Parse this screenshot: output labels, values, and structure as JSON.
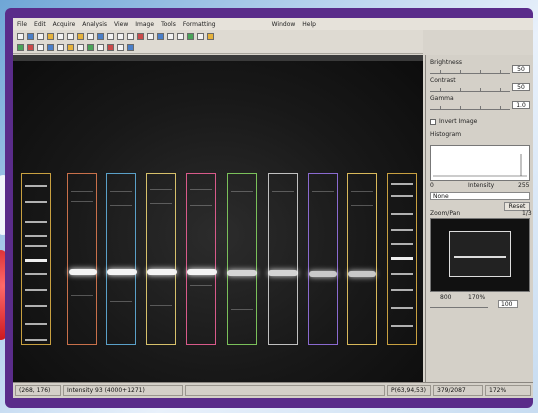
{
  "menu": [
    "File",
    "Edit",
    "Acquire",
    "Analysis",
    "View",
    "Image",
    "Tools",
    "Formatting",
    "Window",
    "Help"
  ],
  "panel": {
    "brightness_label": "Brightness",
    "contrast_label": "Contrast",
    "gamma_label": "Gamma",
    "brightness_value": "50",
    "contrast_value": "50",
    "gamma_value": "1.0",
    "invert_label": "Invert Image",
    "histogram_label": "Histogram",
    "histo_left": "0",
    "histo_mid": "Intensity",
    "histo_right": "255",
    "mode_value": "None",
    "apply_label": "Reset",
    "overview_label": "Zoom/Pan",
    "overview_value": "1/3",
    "zoom_left": "800",
    "zoom_mid": "170%",
    "zoom_field": "100"
  },
  "status": {
    "coords": "(268, 176)",
    "intensity": "Intensity 93 (4000+1271)",
    "pixel": "P(63,94,53)",
    "size": "379/2087",
    "zoom": "172%"
  },
  "lanes": [
    {
      "color": "#c48a3a"
    },
    {
      "color": "#d0507a"
    },
    {
      "color": "#5aa0c8"
    },
    {
      "color": "#d6c06a"
    },
    {
      "color": "#d85a8a"
    },
    {
      "color": "#7ac05a"
    },
    {
      "color": "#c0c0c0"
    },
    {
      "color": "#8a6ad0"
    },
    {
      "color": "#d8b85a"
    }
  ]
}
